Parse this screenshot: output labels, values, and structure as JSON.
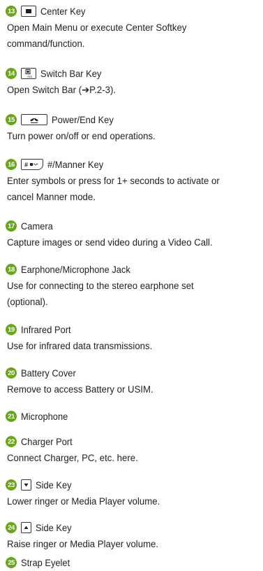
{
  "colors": {
    "number_badge": "#6aa51e",
    "text": "#222222"
  },
  "entries": [
    {
      "num": "13",
      "key_icon": "square-key-icon",
      "title": "Center Key",
      "desc": [
        "Open Main Menu or execute Center Softkey",
        "command/function."
      ]
    },
    {
      "num": "14",
      "key_icon": "switch-bar-key-icon",
      "title": "Switch Bar Key",
      "desc": [
        "Open Switch Bar (➔P.2-3)."
      ]
    },
    {
      "num": "15",
      "key_icon": "power-end-key-icon",
      "title": "Power/End Key",
      "desc": [
        "Turn power on/off or end operations."
      ]
    },
    {
      "num": "16",
      "key_icon": "hash-manner-key-icon",
      "title": "#/Manner Key",
      "desc": [
        "Enter symbols or press for 1+ seconds to activate or",
        "cancel Manner mode."
      ]
    },
    {
      "num": "17",
      "title": "Camera",
      "desc": [
        "Capture images or send video during a Video Call."
      ]
    },
    {
      "num": "18",
      "title": "Earphone/Microphone Jack",
      "desc": [
        "Use for connecting to the stereo earphone set",
        "(optional)."
      ]
    },
    {
      "num": "19",
      "title": "Infrared Port",
      "desc": [
        "Use for infrared data transmissions."
      ]
    },
    {
      "num": "20",
      "title": "Battery Cover",
      "desc": [
        "Remove to access Battery or USIM."
      ]
    },
    {
      "num": "21",
      "title": "Microphone",
      "desc": []
    },
    {
      "num": "22",
      "title": "Charger Port",
      "desc": [
        "Connect Charger, PC, etc. here."
      ]
    },
    {
      "num": "23",
      "key_icon": "side-key-down-icon",
      "title": "Side Key",
      "desc": [
        "Lower ringer or Media Player volume."
      ]
    },
    {
      "num": "24",
      "key_icon": "side-key-up-icon",
      "title": "Side Key",
      "desc": [
        "Raise ringer or Media Player volume."
      ]
    },
    {
      "num": "25",
      "title": "Strap Eyelet",
      "desc": []
    }
  ]
}
